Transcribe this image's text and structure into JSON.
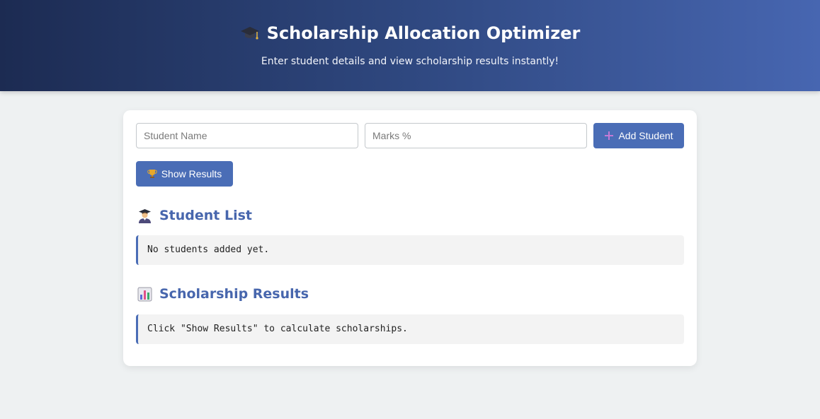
{
  "header": {
    "title": "Scholarship Allocation Optimizer",
    "title_icon": "graduation-cap-icon",
    "subtitle": "Enter student details and view scholarship results instantly!"
  },
  "form": {
    "name_placeholder": "Student Name",
    "marks_placeholder": "Marks %",
    "add_label": "Add Student",
    "add_icon": "plus-icon",
    "show_label": "Show Results",
    "show_icon": "trophy-icon"
  },
  "student_list": {
    "title": "Student List",
    "icon": "student-icon",
    "empty_text": "No students added yet."
  },
  "results": {
    "title": "Scholarship Results",
    "icon": "bar-chart-icon",
    "placeholder_text": "Click \"Show Results\" to calculate scholarships."
  },
  "colors": {
    "accent": "#4a6db6",
    "heading": "#4766ad",
    "header_gradient_start": "#1c2b52",
    "header_gradient_end": "#4766b1",
    "page_background": "#eef1f2"
  }
}
